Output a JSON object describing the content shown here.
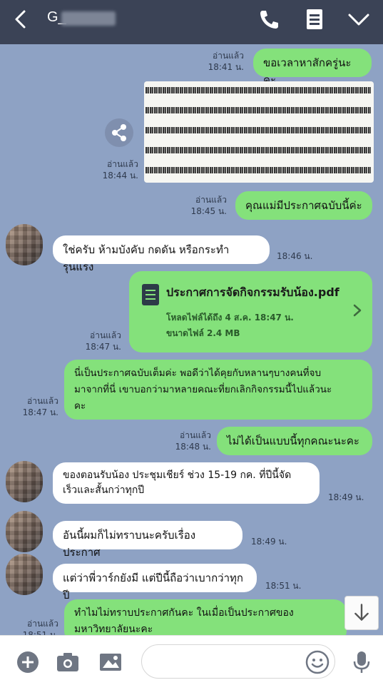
{
  "header": {
    "title": "G_",
    "icons": [
      "back-arrow-icon",
      "phone-icon",
      "notes-icon",
      "chevron-down-icon"
    ]
  },
  "messages": [
    {
      "read": "อ่านแล้ว",
      "time": "18:41 น.",
      "text": "ขอเวลาหาสักครู่นะคะ"
    },
    {
      "read": "อ่านแล้ว",
      "time": "18:44 น.",
      "type": "image"
    },
    {
      "read": "อ่านแล้ว",
      "time": "18:45 น.",
      "text": "คุณแม่มีประกาศฉบับนี้ค่ะ"
    },
    {
      "time": "18:46 น.",
      "text": "ใช่ครับ ห้ามบังคับ กดดัน หรือกระทำรุนแรง"
    },
    {
      "read": "อ่านแล้ว",
      "time": "18:47 น.",
      "type": "file"
    },
    {
      "read": "อ่านแล้ว",
      "time": "18:47 น.",
      "lines": [
        "นี่เป็นประกาศฉบับเต็มค่ะ พอดีว่าได้คุยกับหลานๆบางคนที่จบ",
        "มาจากที่นี่ เขาบอกว่ามาหลายคณะที่ยกเลิกกิจกรรมนี้ไปแล้วนะ",
        "คะ"
      ]
    },
    {
      "read": "อ่านแล้ว",
      "time": "18:48 น.",
      "text": "ไม่ได้เป็นแบบนี้ทุกคณะนะคะ"
    },
    {
      "time": "18:49 น.",
      "lines": [
        "ของตอนรับน้อง ประชุมเชียร์ ช่วง 15-19 กค. ที่ปีนี้จัด",
        "เร็วและสั้นกว่าทุกปี"
      ]
    },
    {
      "time": "18:49 น.",
      "text": "อันนี้ผมก็ไม่ทราบนะครับเรื่องประกาศ"
    },
    {
      "time": "18:51 น.",
      "text": "แต่ว่าพี่วาร์กยังมี แต่ปีนี้ถือว่าเบากว่าทุกปี"
    },
    {
      "read": "อ่านแล้ว",
      "time": "18:51 น.",
      "lines": [
        "ทำไมไม่ทราบประกาศกันคะ ในเมื่อเป็นประกาศของ",
        "มหาวิทยาลัยนะคะ"
      ]
    }
  ],
  "file": {
    "name": "ประกาศการจัดกิจกรรมรับน้อง.pdf",
    "expiry": "โหลดไฟล์ได้ถึง 4 ส.ค. 18:47 น.",
    "size": "ขนาดไฟล์ 2.4 MB"
  },
  "footer": {
    "input_value": "",
    "icons": [
      "plus-icon",
      "camera-icon",
      "image-icon",
      "emoji-icon",
      "microphone-icon"
    ]
  },
  "colors": {
    "header": "#3b4356",
    "chat_bg": "#8ea2c4",
    "my_bubble": "#84e17b",
    "their_bubble": "#ffffff"
  }
}
